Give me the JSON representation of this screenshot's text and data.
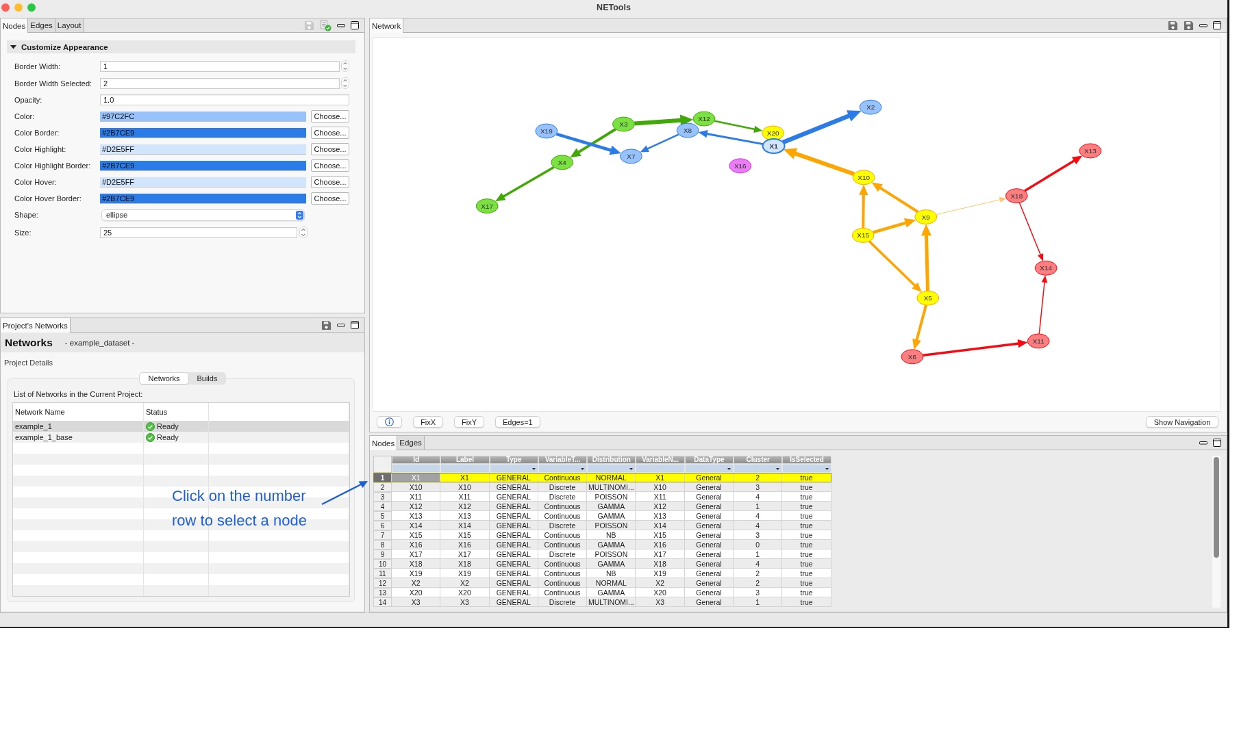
{
  "window": {
    "title": "NETools"
  },
  "appearance_panel": {
    "tabs": [
      {
        "label": "Nodes",
        "selected": true
      },
      {
        "label": "Edges",
        "selected": false
      },
      {
        "label": "Layout",
        "selected": false
      }
    ],
    "toolbar": [
      {
        "kind": "save",
        "disabled": true
      },
      {
        "kind": "export",
        "disabled": false
      }
    ],
    "section": {
      "title": "Customize Appearance",
      "expanded": true
    },
    "fields": [
      {
        "kind": "spinner",
        "label": "Border Width:",
        "value": "1"
      },
      {
        "kind": "spinner",
        "label": "Border Width Selected:",
        "value": "2"
      },
      {
        "kind": "text",
        "label": "Opacity:",
        "value": "1.0"
      },
      {
        "kind": "color",
        "label": "Color:",
        "value": "#97C2FC",
        "color": "#97c2fc",
        "button": "Choose..."
      },
      {
        "kind": "color",
        "label": "Color Border:",
        "value": "#2B7CE9",
        "color": "#2b7ce9",
        "button": "Choose..."
      },
      {
        "kind": "color",
        "label": "Color Highlight:",
        "value": "#D2E5FF",
        "color": "#d2e5ff",
        "button": "Choose..."
      },
      {
        "kind": "color",
        "label": "Color Highlight Border:",
        "value": "#2B7CE9",
        "color": "#2b7ce9",
        "button": "Choose..."
      },
      {
        "kind": "color",
        "label": "Color Hover:",
        "value": "#D2E5FF",
        "color": "#d2e5ff",
        "button": "Choose..."
      },
      {
        "kind": "color",
        "label": "Color Hover Border:",
        "value": "#2B7CE9",
        "color": "#2b7ce9",
        "button": "Choose..."
      },
      {
        "kind": "select",
        "label": "Shape:",
        "value": "ellipse"
      },
      {
        "kind": "smallspinner",
        "label": "Size:",
        "value": "25"
      }
    ]
  },
  "projects_panel": {
    "tab": "Project's Networks",
    "toolbar": [
      {
        "kind": "save",
        "disabled": false
      }
    ],
    "title": "Networks",
    "subtitle": "- example_dataset -",
    "details_label": "Project Details",
    "segments": [
      {
        "label": "Networks",
        "selected": true
      },
      {
        "label": "Builds",
        "selected": false
      }
    ],
    "list_caption": "List of Networks in the Current Project:",
    "columns": [
      "Network Name",
      "Status"
    ],
    "rows": [
      {
        "name": "example_1",
        "status": "Ready",
        "selected": true
      },
      {
        "name": "example_1_base",
        "status": "Ready",
        "selected": false
      }
    ]
  },
  "annotation": {
    "text": "Click on the number row to select a node"
  },
  "network_panel": {
    "tab": "Network",
    "toolbar": [
      {
        "kind": "save",
        "disabled": false
      },
      {
        "kind": "save",
        "disabled": false
      }
    ],
    "graph": {
      "nodes": [
        {
          "label": "X2",
          "color": "#97c2fc",
          "selected": false
        },
        {
          "label": "X19",
          "color": "#97c2fc",
          "selected": false
        },
        {
          "label": "X3",
          "color": "#7be141",
          "selected": false
        },
        {
          "label": "X12",
          "color": "#7be141",
          "selected": false
        },
        {
          "label": "X8",
          "color": "#97c2fc",
          "selected": false
        },
        {
          "label": "X20",
          "color": "#ffff00",
          "selected": false
        },
        {
          "label": "X1",
          "color": "#d2e5ff",
          "selected": true
        },
        {
          "label": "X7",
          "color": "#97c2fc",
          "selected": false
        },
        {
          "label": "X4",
          "color": "#7be141",
          "selected": false
        },
        {
          "label": "X16",
          "color": "#eb7df4",
          "selected": false
        },
        {
          "label": "X17",
          "color": "#7be141",
          "selected": false
        },
        {
          "label": "X10",
          "color": "#ffff00",
          "selected": false
        },
        {
          "label": "X18",
          "color": "#fb7e81",
          "selected": false
        },
        {
          "label": "X13",
          "color": "#fb7e81",
          "selected": false
        },
        {
          "label": "X9",
          "color": "#ffff00",
          "selected": false
        },
        {
          "label": "X15",
          "color": "#ffff00",
          "selected": false
        },
        {
          "label": "X14",
          "color": "#fb7e81",
          "selected": false
        },
        {
          "label": "X5",
          "color": "#ffff00",
          "selected": false
        },
        {
          "label": "X11",
          "color": "#fb7e81",
          "selected": false
        },
        {
          "label": "X6",
          "color": "#fb7e81",
          "selected": false
        }
      ]
    },
    "buttons": [
      {
        "kind": "info"
      },
      {
        "kind": "text",
        "label": "FixX"
      },
      {
        "kind": "text",
        "label": "FixY"
      },
      {
        "kind": "text",
        "label": "Edges=1"
      }
    ],
    "navigation_button": "Show Navigation"
  },
  "nodes_panel": {
    "tabs": [
      {
        "label": "Nodes",
        "selected": true
      },
      {
        "label": "Edges",
        "selected": false
      }
    ],
    "columns": [
      {
        "label": "Id",
        "filter": false
      },
      {
        "label": "Label",
        "filter": false
      },
      {
        "label": "Type",
        "filter": true
      },
      {
        "label": "VariableT...",
        "filter": true
      },
      {
        "label": "Distribution",
        "filter": true
      },
      {
        "label": "VariableN...",
        "filter": false
      },
      {
        "label": "DataType",
        "filter": true
      },
      {
        "label": "Cluster",
        "filter": true
      },
      {
        "label": "IsSelected",
        "filter": true
      }
    ],
    "rows": [
      {
        "number": "1",
        "selected": true,
        "cells": [
          "X1",
          "X1",
          "GENERAL",
          "Continuous",
          "NORMAL",
          "X1",
          "General",
          "2",
          "true"
        ]
      },
      {
        "number": "2",
        "selected": false,
        "cells": [
          "X10",
          "X10",
          "GENERAL",
          "Discrete",
          "MULTINOMI...",
          "X10",
          "General",
          "3",
          "true"
        ]
      },
      {
        "number": "3",
        "selected": false,
        "cells": [
          "X11",
          "X11",
          "GENERAL",
          "Discrete",
          "POISSON",
          "X11",
          "General",
          "4",
          "true"
        ]
      },
      {
        "number": "4",
        "selected": false,
        "cells": [
          "X12",
          "X12",
          "GENERAL",
          "Continuous",
          "GAMMA",
          "X12",
          "General",
          "1",
          "true"
        ]
      },
      {
        "number": "5",
        "selected": false,
        "cells": [
          "X13",
          "X13",
          "GENERAL",
          "Continuous",
          "GAMMA",
          "X13",
          "General",
          "4",
          "true"
        ]
      },
      {
        "number": "6",
        "selected": false,
        "cells": [
          "X14",
          "X14",
          "GENERAL",
          "Discrete",
          "POISSON",
          "X14",
          "General",
          "4",
          "true"
        ]
      },
      {
        "number": "7",
        "selected": false,
        "cells": [
          "X15",
          "X15",
          "GENERAL",
          "Continuous",
          "NB",
          "X15",
          "General",
          "3",
          "true"
        ]
      },
      {
        "number": "8",
        "selected": false,
        "cells": [
          "X16",
          "X16",
          "GENERAL",
          "Continuous",
          "GAMMA",
          "X16",
          "General",
          "0",
          "true"
        ]
      },
      {
        "number": "9",
        "selected": false,
        "cells": [
          "X17",
          "X17",
          "GENERAL",
          "Discrete",
          "POISSON",
          "X17",
          "General",
          "1",
          "true"
        ]
      },
      {
        "number": "10",
        "selected": false,
        "cells": [
          "X18",
          "X18",
          "GENERAL",
          "Continuous",
          "GAMMA",
          "X18",
          "General",
          "4",
          "true"
        ]
      },
      {
        "number": "11",
        "selected": false,
        "cells": [
          "X19",
          "X19",
          "GENERAL",
          "Continuous",
          "NB",
          "X19",
          "General",
          "2",
          "true"
        ]
      },
      {
        "number": "12",
        "selected": false,
        "cells": [
          "X2",
          "X2",
          "GENERAL",
          "Continuous",
          "NORMAL",
          "X2",
          "General",
          "2",
          "true"
        ]
      },
      {
        "number": "13",
        "selected": false,
        "cells": [
          "X20",
          "X20",
          "GENERAL",
          "Continuous",
          "GAMMA",
          "X20",
          "General",
          "3",
          "true"
        ]
      },
      {
        "number": "14",
        "selected": false,
        "cells": [
          "X3",
          "X3",
          "GENERAL",
          "Discrete",
          "MULTINOMI...",
          "X3",
          "General",
          "1",
          "true"
        ]
      }
    ]
  }
}
